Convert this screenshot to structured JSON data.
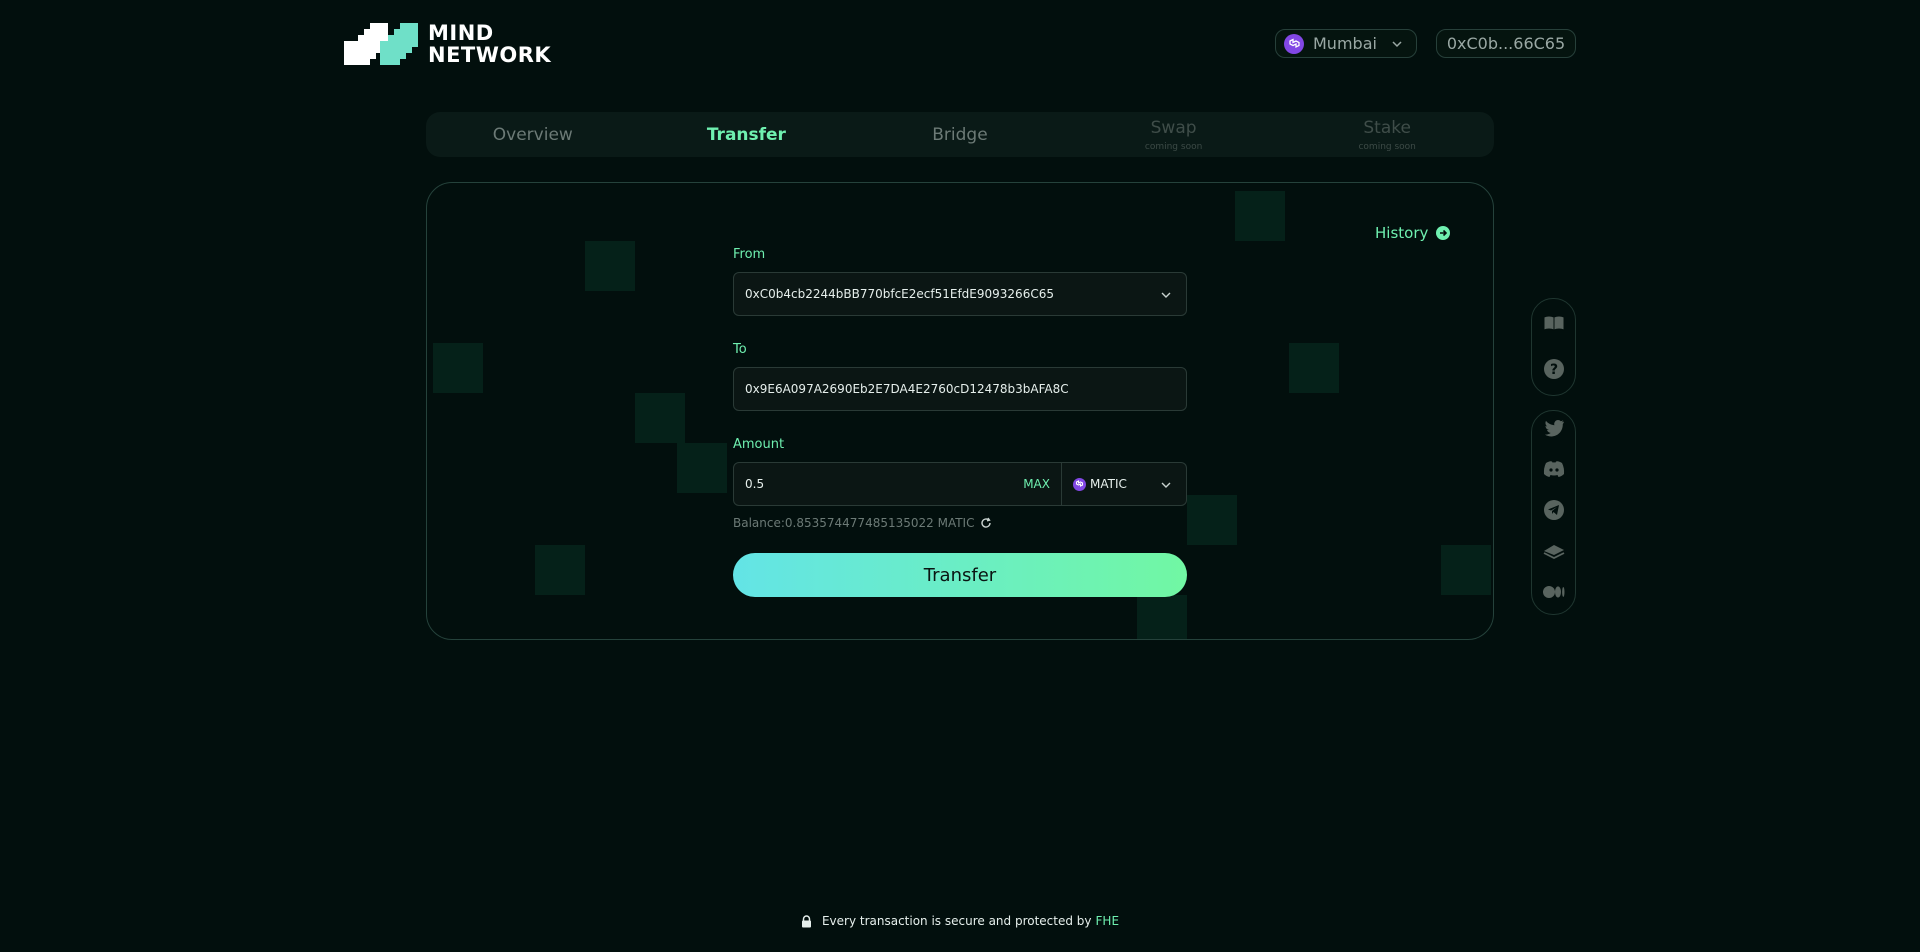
{
  "brand": {
    "line1": "MIND",
    "line2": "NETWORK"
  },
  "header": {
    "network": "Mumbai",
    "wallet": "0xC0b...66C65"
  },
  "tabs": [
    {
      "label": "Overview",
      "sub": "",
      "state": "default"
    },
    {
      "label": "Transfer",
      "sub": "",
      "state": "active"
    },
    {
      "label": "Bridge",
      "sub": "",
      "state": "default"
    },
    {
      "label": "Swap",
      "sub": "coming soon",
      "state": "disabled"
    },
    {
      "label": "Stake",
      "sub": "coming soon",
      "state": "disabled"
    }
  ],
  "transfer": {
    "history_label": "History",
    "from_label": "From",
    "from_value": "0xC0b4cb2244bBB770bfcE2ecf51EfdE9093266C65",
    "to_label": "To",
    "to_value": "0x9E6A097A2690Eb2E7DA4E2760cD12478b3bAFA8C",
    "amount_label": "Amount",
    "amount_value": "0.5",
    "max_label": "MAX",
    "token": "MATIC",
    "balance": "Balance:0.853574477485135022 MATIC",
    "submit_label": "Transfer"
  },
  "side_icons": {
    "group1": [
      "book-icon",
      "help-icon"
    ],
    "group2": [
      "twitter-icon",
      "discord-icon",
      "telegram-icon",
      "gitbook-icon",
      "medium-icon"
    ]
  },
  "footer": {
    "text": "Every transaction is secure and protected by",
    "highlight": "FHE"
  },
  "colors": {
    "background": "#020f0d",
    "accent": "#6ff0b0",
    "gradient_start": "#63e4e6",
    "gradient_end": "#71f7a3",
    "polygon": "#8247e5"
  }
}
